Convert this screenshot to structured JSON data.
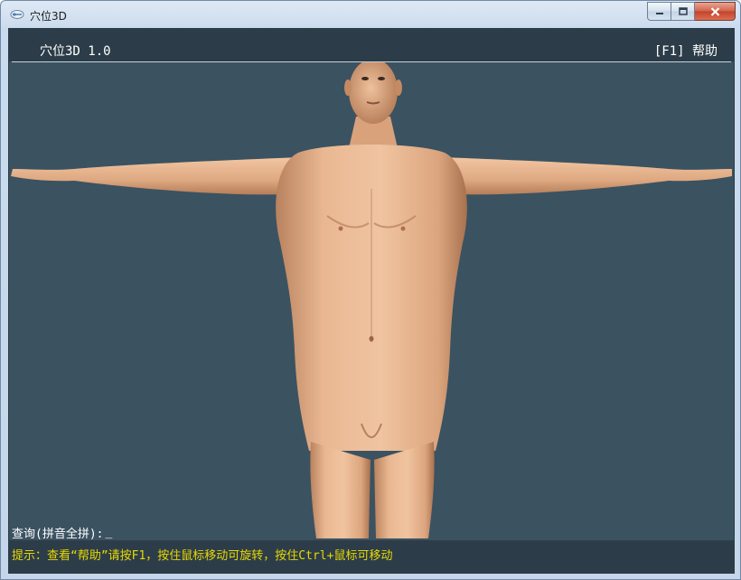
{
  "window": {
    "title": "穴位3D"
  },
  "header": {
    "app_title": "穴位3D 1.0",
    "help_label": "[F1] 帮助"
  },
  "query": {
    "label": "查询(拼音全拼):",
    "value": "_"
  },
  "status": {
    "hint": "提示：查看“帮助”请按F1，按住鼠标移动可旋转，按住Ctrl+鼠标可移动"
  },
  "colors": {
    "background": "#3b5261",
    "bar": "#2c3d49",
    "hint_text": "#e8d800",
    "skin": "#e7b48d"
  },
  "icons": {
    "app": "app-logo-icon",
    "minimize": "minimize-icon",
    "maximize": "maximize-icon",
    "close": "close-icon"
  }
}
